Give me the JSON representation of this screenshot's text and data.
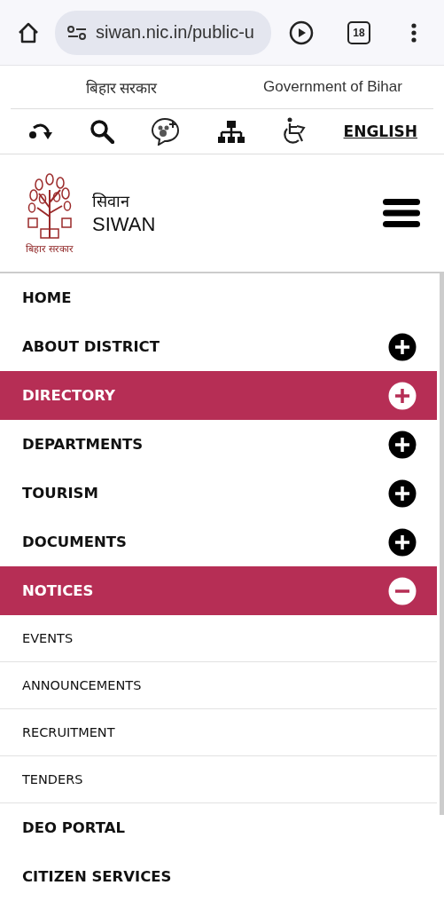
{
  "browser": {
    "url": "siwan.nic.in/public-u",
    "tab_count": "18"
  },
  "gov_bar": {
    "hindi": "बिहार सरकार",
    "english": "Government of Bihar"
  },
  "toolbar": {
    "language": "ENGLISH"
  },
  "site_header": {
    "emblem_caption": "बिहार सरकार",
    "name_hindi": "सिवान",
    "name": "SIWAN"
  },
  "menu": [
    {
      "label": "HOME",
      "kind": "link",
      "selected": false
    },
    {
      "label": "ABOUT DISTRICT",
      "kind": "group",
      "selected": false,
      "expanded": false
    },
    {
      "label": "DIRECTORY",
      "kind": "group",
      "selected": true,
      "expanded": false
    },
    {
      "label": "DEPARTMENTS",
      "kind": "group",
      "selected": false,
      "expanded": false
    },
    {
      "label": "TOURISM",
      "kind": "group",
      "selected": false,
      "expanded": false
    },
    {
      "label": "DOCUMENTS",
      "kind": "group",
      "selected": false,
      "expanded": false
    },
    {
      "label": "NOTICES",
      "kind": "group",
      "selected": true,
      "expanded": true,
      "children": [
        {
          "label": "EVENTS",
          "kind": "sub",
          "selected": false
        },
        {
          "label": "ANNOUNCEMENTS",
          "kind": "sub",
          "selected": false
        },
        {
          "label": "RECRUITMENT",
          "kind": "sub",
          "selected": false
        },
        {
          "label": "TENDERS",
          "kind": "sub",
          "selected": false
        }
      ]
    },
    {
      "label": "DEO PORTAL",
      "kind": "link",
      "selected": false
    },
    {
      "label": "CITIZEN SERVICES",
      "kind": "link",
      "selected": false
    }
  ]
}
